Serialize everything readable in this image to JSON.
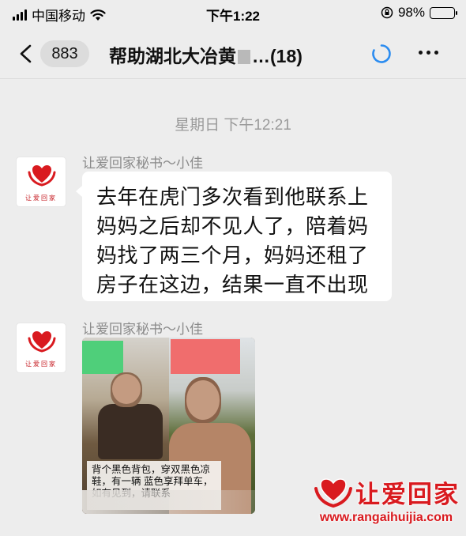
{
  "status_bar": {
    "carrier": "中国移动",
    "time": "下午1:22",
    "battery": "98%",
    "battery_level": 0.98,
    "icons": [
      "signal-icon",
      "wifi-icon",
      "rotation-lock-icon",
      "battery-icon"
    ]
  },
  "nav_bar": {
    "back_icon": "chevron-left-icon",
    "unread_count": "883",
    "title_prefix": "帮助湖北大冶黄",
    "title_suffix": "…(18)",
    "loading_icon": "loading-icon",
    "more_icon": "more-dots-icon"
  },
  "chat": {
    "timestamp": "星期日 下午12:21",
    "messages": [
      {
        "sender": "让爱回家秘书～小佳",
        "avatar_text": "让爱回家",
        "type": "text",
        "text": "去年在虎门多次看到他联系上妈妈之后却不见人了，陪着妈妈找了两三个月，妈妈还租了房子在这边，结果一直不出现"
      },
      {
        "sender": "让爱回家秘书～小佳",
        "avatar_text": "让爱回家",
        "type": "image",
        "caption": "背个黑色背包，穿双黑色凉鞋，有一辆 蓝色享拜单车，如有见到，请联系"
      }
    ]
  },
  "watermark": {
    "title": "让爱回家",
    "url": "www.rangaihuijia.com"
  },
  "colors": {
    "background": "#ededed",
    "bubble": "#ffffff",
    "brand_red": "#d91a1f",
    "accent_blue": "#2b8cf0"
  }
}
